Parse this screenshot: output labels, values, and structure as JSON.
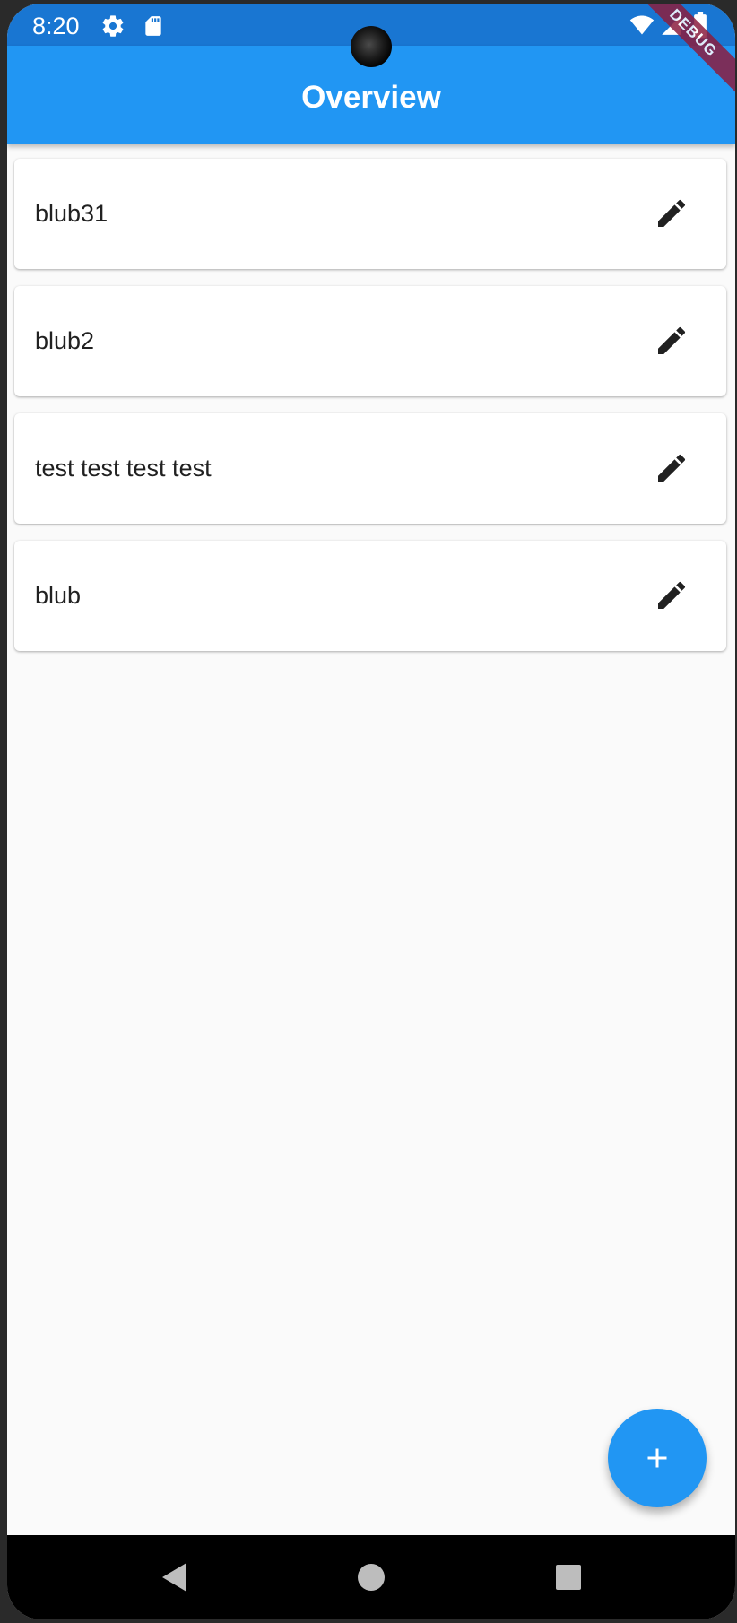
{
  "status_bar": {
    "time": "8:20",
    "icons": [
      "gear-icon",
      "sd-card-icon",
      "wifi-icon",
      "signal-icon",
      "battery-icon"
    ]
  },
  "app_bar": {
    "title": "Overview",
    "debug_banner": "DEBUG"
  },
  "items": [
    {
      "label": "blub31",
      "action_icon": "edit-icon"
    },
    {
      "label": "blub2",
      "action_icon": "edit-icon"
    },
    {
      "label": "test test test test",
      "action_icon": "edit-icon"
    },
    {
      "label": "blub",
      "action_icon": "edit-icon"
    }
  ],
  "fab": {
    "icon": "plus-icon"
  },
  "nav_bar": {
    "buttons": [
      "back-icon",
      "home-icon",
      "recents-icon"
    ]
  },
  "colors": {
    "primary": "#2196f3",
    "primary_dark": "#1976d2",
    "background": "#fafafa",
    "card": "#ffffff",
    "debug_banner": "#8b1e3f"
  }
}
